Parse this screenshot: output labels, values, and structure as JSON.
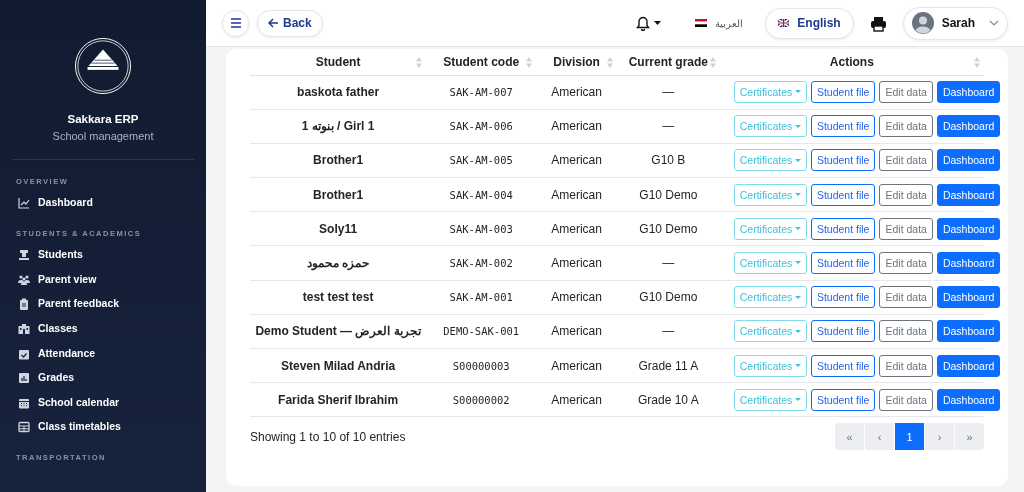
{
  "sidebar": {
    "brand": "Sakkara ERP",
    "subtitle": "School management",
    "sections": [
      {
        "title": "OVERVIEW",
        "items": [
          {
            "label": "Dashboard"
          }
        ]
      },
      {
        "title": "STUDENTS & ACADEMICS",
        "items": [
          {
            "label": "Students"
          },
          {
            "label": "Parent view"
          },
          {
            "label": "Parent feedback"
          },
          {
            "label": "Classes"
          },
          {
            "label": "Attendance"
          },
          {
            "label": "Grades"
          },
          {
            "label": "School calendar"
          },
          {
            "label": "Class timetables"
          }
        ]
      },
      {
        "title": "TRANSPORTATION"
      }
    ]
  },
  "topbar": {
    "back": "Back",
    "lang_ar": "العربية",
    "lang_en": "English",
    "user": "Sarah"
  },
  "table": {
    "columns": [
      "Student",
      "Student code",
      "Division",
      "Current grade",
      "Actions"
    ],
    "rows": [
      {
        "student": "baskota father",
        "code": "SAK-AM-007",
        "division": "American",
        "grade": "—",
        "actions": [
          "Certificates",
          "Student file",
          "Edit data",
          "Dashboard"
        ]
      },
      {
        "student": "1 بنوته / Girl 1",
        "code": "SAK-AM-006",
        "division": "American",
        "grade": "—",
        "actions": [
          "Certificates",
          "Student file",
          "Edit data",
          "Dashboard"
        ]
      },
      {
        "student": "Brother1",
        "code": "SAK-AM-005",
        "division": "American",
        "grade": "G10 B",
        "actions": [
          "Certificates",
          "Student file",
          "Edit data",
          "Dashboard"
        ]
      },
      {
        "student": "Brother1",
        "code": "SAK-AM-004",
        "division": "American",
        "grade": "G10 Demo",
        "actions": [
          "Certificates",
          "Student file",
          "Edit data",
          "Dashboard"
        ]
      },
      {
        "student": "Soly11",
        "code": "SAK-AM-003",
        "division": "American",
        "grade": "G10 Demo",
        "actions": [
          "Certificates",
          "Student file",
          "Edit data",
          "Dashboard"
        ]
      },
      {
        "student": "حمزه محمود",
        "code": "SAK-AM-002",
        "division": "American",
        "grade": "—",
        "actions": [
          "Certificates",
          "Student file",
          "Edit data",
          "Dashboard"
        ]
      },
      {
        "student": "test test test",
        "code": "SAK-AM-001",
        "division": "American",
        "grade": "G10 Demo",
        "actions": [
          "Certificates",
          "Student file",
          "Edit data",
          "Dashboard"
        ]
      },
      {
        "student": "Demo Student — تجربة العرض",
        "code": "DEMO-SAK-001",
        "division": "American",
        "grade": "—",
        "actions": [
          "Certificates",
          "Student file",
          "Edit data",
          "Dashboard"
        ]
      },
      {
        "student": "Steven Milad Andria",
        "code": "S00000003",
        "division": "American",
        "grade": "Grade 11 A",
        "actions": [
          "Certificates",
          "Student file",
          "Edit data",
          "Dashboard"
        ]
      },
      {
        "student": "Farida Sherif Ibrahim",
        "code": "S00000002",
        "division": "American",
        "grade": "Grade 10 A",
        "actions": [
          "Certificates",
          "Student file",
          "Edit data",
          "Dashboard"
        ]
      }
    ]
  },
  "footer": {
    "info": "Showing 1 to 10 of 10 entries",
    "pages": [
      {
        "label": "«",
        "selected": false
      },
      {
        "label": "‹",
        "selected": false
      },
      {
        "label": "1",
        "selected": true
      },
      {
        "label": "›",
        "selected": false
      },
      {
        "label": "»",
        "selected": false
      }
    ]
  }
}
